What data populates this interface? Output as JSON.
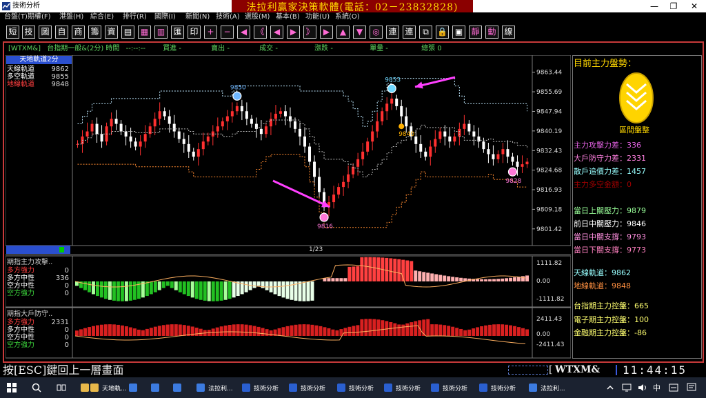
{
  "window": {
    "title": "技術分析",
    "min": "—",
    "max": "❐",
    "close": "✕"
  },
  "menu": [
    "台盤(T)",
    "期權(F)",
    "港盤(H)",
    "綜合(E)",
    "排行(R)",
    "國際(I)",
    "新聞(N)",
    "技術(A)",
    "選股(M)",
    "基本(B)",
    "功能(U)",
    "系統(O)"
  ],
  "banner": "法拉利贏家決策軟體(電話：02－23832828)",
  "toolbar": [
    {
      "label": "短",
      "icon": "short-icon",
      "color": "#fff"
    },
    {
      "label": "技",
      "icon": "tech-icon",
      "color": "#fff"
    },
    {
      "label": "圖",
      "icon": "chart-icon",
      "color": "#fff"
    },
    {
      "label": "自",
      "icon": "custom-icon",
      "color": "#fff"
    },
    {
      "label": "商",
      "icon": "product-icon",
      "color": "#fff"
    },
    {
      "label": "籌",
      "icon": "chips-icon",
      "color": "#fff"
    },
    {
      "label": "資",
      "icon": "data-icon",
      "color": "#fff"
    },
    {
      "label": "▤",
      "icon": "list-icon",
      "color": "#fff"
    },
    {
      "label": "▦",
      "icon": "grid-icon",
      "color": "#ff6bd5"
    },
    {
      "label": "▥",
      "icon": "table-icon",
      "color": "#ff6bd5"
    },
    {
      "label": "匯",
      "icon": "export-icon",
      "color": "#fff"
    },
    {
      "label": "印",
      "icon": "print-icon",
      "color": "#fff"
    },
    {
      "label": "+",
      "icon": "plus-icon",
      "color": "#ff6bd5"
    },
    {
      "label": "−",
      "icon": "minus-icon",
      "color": "#ff6bd5"
    },
    {
      "label": "◀",
      "icon": "left-icon",
      "color": "#ff6bd5"
    },
    {
      "label": "《",
      "icon": "fast-left-icon",
      "color": "#ff6bd5"
    },
    {
      "label": "◀",
      "icon": "prev-icon",
      "color": "#ff6bd5"
    },
    {
      "label": "▶",
      "icon": "next-icon",
      "color": "#ff6bd5"
    },
    {
      "label": "》",
      "icon": "fast-right-icon",
      "color": "#ff6bd5"
    },
    {
      "label": "▶",
      "icon": "right-icon",
      "color": "#ff6bd5"
    },
    {
      "label": "▲",
      "icon": "up-icon",
      "color": "#ff6bd5"
    },
    {
      "label": "▼",
      "icon": "down-icon",
      "color": "#ff6bd5"
    },
    {
      "label": "◎",
      "icon": "target-icon",
      "color": "#ff6bd5"
    },
    {
      "label": "連",
      "icon": "link-icon",
      "color": "#fff"
    },
    {
      "label": "連",
      "icon": "link2-icon",
      "color": "#fff"
    },
    {
      "label": "⧉",
      "icon": "window-icon",
      "color": "#fff"
    },
    {
      "label": "🔒",
      "icon": "lock-icon",
      "color": "#ff6bd5"
    },
    {
      "label": "▣",
      "icon": "box-icon",
      "color": "#fff"
    },
    {
      "label": "靜",
      "icon": "static-icon",
      "color": "#ff6bd5"
    },
    {
      "label": "動",
      "icon": "dynamic-icon",
      "color": "#ff6bd5"
    },
    {
      "label": "線",
      "icon": "line-icon",
      "color": "#fff"
    }
  ],
  "info": {
    "symbol": "[WTXM&]",
    "name": "台指期一般&(2分)",
    "time_label": "時間",
    "time": "--:--:--",
    "buy": "買進  -",
    "sell": "賣出  -",
    "deal": "成交  -",
    "chg": "漲跌  -",
    "vol": "單量  -",
    "total": "總張  0"
  },
  "legend_main": {
    "title": "天地軌道2分",
    "items": [
      {
        "name": "天線軌道",
        "value": "9862",
        "color": "#fff"
      },
      {
        "name": "多空軌道",
        "value": "9855",
        "color": "#fff"
      },
      {
        "name": "地線軌道",
        "value": "9848",
        "color": "#ff4040"
      }
    ]
  },
  "page_indicator": "1/23",
  "chart_data": {
    "type": "candlestick",
    "ylim": [
      9797,
      9868
    ],
    "yticks": [
      "9863.44",
      "9855.69",
      "9847.94",
      "9840.19",
      "9832.43",
      "9824.68",
      "9816.93",
      "9809.18",
      "9801.42"
    ],
    "markers": [
      {
        "label": "9850",
        "color": "#6fb7ff"
      },
      {
        "label": "9853",
        "color": "#6fd8ff"
      },
      {
        "label": "9816",
        "color": "#ff77d8"
      },
      {
        "label": "9828",
        "color": "#ff77d8"
      },
      {
        "label": "9840",
        "color": "#ffb000"
      }
    ],
    "close": [
      9835,
      9838,
      9840,
      9843,
      9839,
      9836,
      9842,
      9845,
      9843,
      9840,
      9838,
      9836,
      9834,
      9836,
      9839,
      9842,
      9845,
      9848,
      9846,
      9843,
      9840,
      9837,
      9835,
      9832,
      9830,
      9833,
      9836,
      9838,
      9840,
      9842,
      9844,
      9846,
      9848,
      9850,
      9848,
      9845,
      9843,
      9841,
      9839,
      9842,
      9845,
      9847,
      9848,
      9846,
      9844,
      9841,
      9838,
      9834,
      9828,
      9822,
      9816,
      9810,
      9812,
      9815,
      9818,
      9820,
      9823,
      9826,
      9829,
      9832,
      9836,
      9840,
      9844,
      9848,
      9851,
      9853,
      9850,
      9846,
      9842,
      9838,
      9835,
      9832,
      9830,
      9834,
      9837,
      9840,
      9838,
      9836,
      9838,
      9841,
      9843,
      9840,
      9838,
      9836,
      9833,
      9831,
      9829,
      9831,
      9833,
      9830,
      9828,
      9826,
      9827,
      9828
    ]
  },
  "ind1": {
    "title": "期指主力攻擊..",
    "items": [
      {
        "name": "多方強力",
        "value": "0",
        "color": "#ff4040"
      },
      {
        "name": "多方中性",
        "value": "336",
        "color": "#fff"
      },
      {
        "name": "空方中性",
        "value": "0",
        "color": "#fff"
      },
      {
        "name": "空方強力",
        "value": "0",
        "color": "#3cd63c"
      }
    ],
    "yticks": [
      "1111.82",
      "0.00",
      "-1111.82"
    ]
  },
  "ind2": {
    "title": "期指大戶防守..",
    "items": [
      {
        "name": "多方強力",
        "value": "2331",
        "color": "#ff4040"
      },
      {
        "name": "多方中性",
        "value": "0",
        "color": "#fff"
      },
      {
        "name": "空方中性",
        "value": "0",
        "color": "#fff"
      },
      {
        "name": "空方強力",
        "value": "0",
        "color": "#3cd63c"
      }
    ],
    "yticks": [
      "2411.43",
      "0.00",
      "-2411.43"
    ]
  },
  "right": {
    "title": "目前主力盤勢：",
    "badge": "區間盤整",
    "rows": [
      {
        "label": "主力攻擊力差：",
        "value": "336",
        "color": "#e060e0"
      },
      {
        "label": "大戶防守力差：",
        "value": "2331",
        "color": "#ff80e0"
      },
      {
        "label": "散戶追價力差：",
        "value": "1457",
        "color": "#9ff"
      },
      {
        "label": "主力多空金額：",
        "value": "0",
        "color": "#a00000"
      },
      {
        "label": "當日上關壓力：",
        "value": "9879",
        "color": "#9f9"
      },
      {
        "label": "前日中關壓力：",
        "value": "9846",
        "color": "#fff"
      },
      {
        "label": "當日中關支撐：",
        "value": "9793",
        "color": "#ff90e0"
      },
      {
        "label": "當日下關支撐：",
        "value": "9773",
        "color": "#ff80c0"
      },
      {
        "label": "天線軌道：",
        "value": "9862",
        "color": "#9ff"
      },
      {
        "label": "地線軌道：",
        "value": "9848",
        "color": "#ff9040"
      },
      {
        "label": "台指期主力控盤：",
        "value": "665",
        "color": "#ffff70"
      },
      {
        "label": "電子期主力控盤：",
        "value": "100",
        "color": "#ffff70"
      },
      {
        "label": "金融期主力控盤：",
        "value": "-86",
        "color": "#ffff70"
      }
    ]
  },
  "status": {
    "hint": "按[ESC]鍵回上一層畫面",
    "symbol": "WTXM&",
    "clock": "11:44:15"
  },
  "taskbar": {
    "items": [
      {
        "label": "",
        "icon": "folder-icon"
      },
      {
        "label": "天地軌...",
        "icon": "folder-icon"
      },
      {
        "label": "",
        "icon": "store-icon"
      },
      {
        "label": "",
        "icon": "edge-icon"
      },
      {
        "label": "",
        "icon": "chrome-icon"
      },
      {
        "label": "法拉利...",
        "icon": "app-icon"
      },
      {
        "label": "技術分析",
        "icon": "chart-app-icon"
      },
      {
        "label": "技術分析",
        "icon": "chart-app-icon"
      },
      {
        "label": "技術分析",
        "icon": "chart-app-icon"
      },
      {
        "label": "技術分析",
        "icon": "chart-app-icon"
      },
      {
        "label": "技術分析",
        "icon": "chart-app-icon"
      },
      {
        "label": "技術分析",
        "icon": "chart-app-icon"
      },
      {
        "label": "法拉利...",
        "icon": "app2-icon"
      }
    ],
    "lang": "中"
  }
}
